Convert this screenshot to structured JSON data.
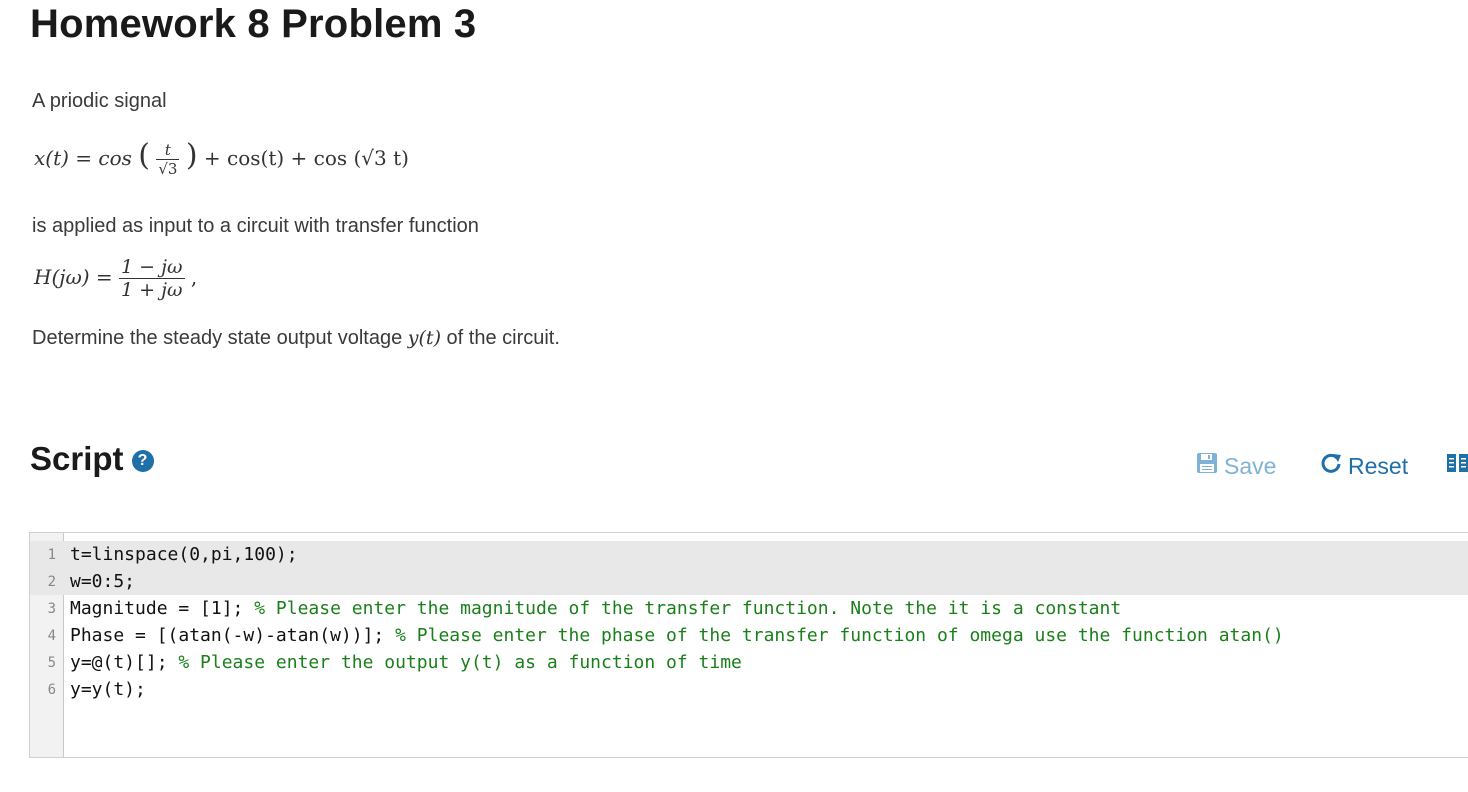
{
  "page": {
    "title": "Homework 8 Problem 3"
  },
  "problem": {
    "intro": "A priodic signal",
    "signal_lhs": "x(t) = cos",
    "signal_num": "t",
    "signal_den": "√3",
    "signal_rest": "+ cos(t) + cos (√3 t)",
    "input_sentence": "is applied as input to a  circuit with transfer function",
    "tf_lhs": "H(jω) =",
    "tf_num": "1 − jω",
    "tf_den": "1 + jω",
    "tf_end": ",",
    "determine_before": "Determine the steady state output voltage ",
    "determine_math": "y(t)",
    "determine_after": " of the circuit."
  },
  "script": {
    "heading": "Script",
    "help_icon": "?",
    "save_label": "Save",
    "reset_label": "Reset"
  },
  "editor": {
    "lines": [
      {
        "num": "1",
        "code": "t=linspace(0,pi,100);",
        "comment": ""
      },
      {
        "num": "2",
        "code": "w=0:5;",
        "comment": ""
      },
      {
        "num": "3",
        "code": "Magnitude = [1]; ",
        "comment": "% Please enter the magnitude of the transfer function. Note the it is a constant"
      },
      {
        "num": "4",
        "code": "Phase = [(atan(-w)-atan(w))]; ",
        "comment": "% Please enter the phase of the transfer function of omega use the function atan()"
      },
      {
        "num": "5",
        "code": "y=@(t)[]; ",
        "comment": "% Please enter the output y(t) as a function of time"
      },
      {
        "num": "6",
        "code": "y=y(t);",
        "comment": ""
      }
    ]
  },
  "colors": {
    "link_blue": "#1f6fa8",
    "save_disabled": "#7fb3d5",
    "comment_green": "#1a7f1a"
  },
  "icons": [
    "help-icon",
    "save-icon",
    "reset-icon",
    "book-icon"
  ]
}
